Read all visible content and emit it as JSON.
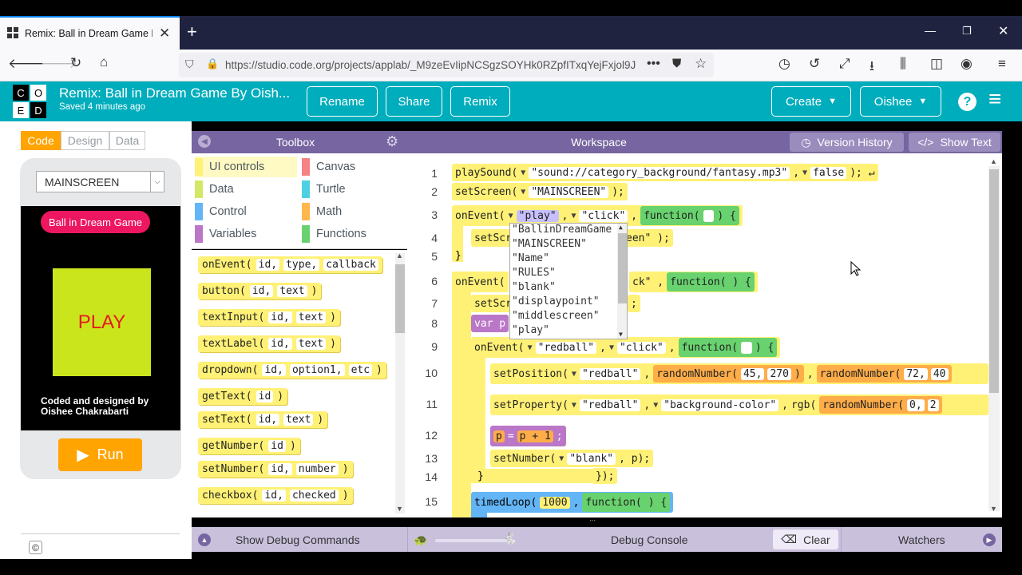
{
  "browser": {
    "tab_title": "Remix: Ball in Dream Game By",
    "url": "https://studio.code.org/projects/applab/_M9zeEvIipNCSgzSOYHk0RZpfITxqYejFxjol9J"
  },
  "header": {
    "logo_letters": [
      "C",
      "O",
      "D",
      "E"
    ],
    "project_title": "Remix: Ball in Dream Game By Oish...",
    "saved_status": "Saved 4 minutes ago",
    "buttons": {
      "rename": "Rename",
      "share": "Share",
      "remix": "Remix",
      "create": "Create",
      "user": "Oishee"
    }
  },
  "modes": {
    "code": "Code",
    "design": "Design",
    "data": "Data"
  },
  "app": {
    "screen_select": "MAINSCREEN",
    "title_label": "Ball in Dream Game",
    "play_label": "PLAY",
    "credits": "Coded and designed by\nOishee Chakrabarti",
    "run_label": "Run",
    "copyright": "©"
  },
  "toolbox": {
    "title": "Toolbox",
    "categories": [
      {
        "label": "UI controls",
        "color": "#fff176"
      },
      {
        "label": "Canvas",
        "color": "#f78183"
      },
      {
        "label": "Data",
        "color": "#d3e965"
      },
      {
        "label": "Turtle",
        "color": "#4dd0e1"
      },
      {
        "label": "Control",
        "color": "#64b5f6"
      },
      {
        "label": "Math",
        "color": "#ffb74d"
      },
      {
        "label": "Variables",
        "color": "#bb77c7"
      },
      {
        "label": "Functions",
        "color": "#68d26e"
      }
    ],
    "blocks": [
      {
        "name": "onEvent(",
        "args": [
          "id,",
          "type,",
          "callback"
        ],
        "end": ""
      },
      {
        "name": "button(",
        "args": [
          "id,",
          "text"
        ],
        "end": ")"
      },
      {
        "name": "textInput(",
        "args": [
          "id,",
          "text"
        ],
        "end": ")"
      },
      {
        "name": "textLabel(",
        "args": [
          "id,",
          "text"
        ],
        "end": ")"
      },
      {
        "name": "dropdown(",
        "args": [
          "id,",
          "option1,",
          "etc"
        ],
        "end": ")"
      },
      {
        "name": "getText(",
        "args": [
          "id"
        ],
        "end": ")"
      },
      {
        "name": "setText(",
        "args": [
          "id,",
          "text"
        ],
        "end": ")"
      },
      {
        "name": "getNumber(",
        "args": [
          "id"
        ],
        "end": ")"
      },
      {
        "name": "setNumber(",
        "args": [
          "id,",
          "number"
        ],
        "end": ")"
      },
      {
        "name": "checkbox(",
        "args": [
          "id,",
          "checked"
        ],
        "end": ")"
      }
    ]
  },
  "workspace": {
    "title": "Workspace",
    "version_history": "Version History",
    "show_text": "Show Text",
    "line_numbers": [
      "1",
      "2",
      "3",
      "4",
      "5",
      "6",
      "7",
      "8",
      "9",
      "10",
      "11",
      "12",
      "13",
      "14",
      "15"
    ],
    "code": {
      "l1_fn": "playSound(",
      "l1_arg1": "\"sound://category_background/fantasy.mp3\"",
      "l1_arg2": "false",
      "l1_end": "); ↵",
      "l2_fn": "setScreen(",
      "l2_arg": "\"MAINSCREEN\"",
      "l2_end": ");",
      "l3_fn": "onEvent(",
      "l3_arg1": "\"play\"",
      "l3_arg2": "\"click\"",
      "l3_func": "function(",
      "l3_end": ") {",
      "l4_fn": "setScr",
      "l4_tail": "een\"  );",
      "l5": "}",
      "l6_fn": "onEvent(",
      "l6_tail": "ck\"  ,",
      "l6_func": "function(  )  {",
      "l7_fn": "setScr",
      "l7_tail": ";",
      "l8_fn": "var p",
      "l9_fn": "onEvent(",
      "l9_arg1": "\"redball\"",
      "l9_arg2": "\"click\"",
      "l9_func": "function(",
      "l9_end": ") {",
      "l10_fn": "setPosition(",
      "l10_arg": "\"redball\"",
      "l10_rand1": "randomNumber(",
      "l10_a": "45,",
      "l10_b": "270",
      "l10_rand2": "randomNumber(",
      "l10_c": "72,",
      "l10_d": "40",
      "l11_fn": "setProperty(",
      "l11_arg1": "\"redball\"",
      "l11_arg2": "\"background-color\"",
      "l11_rgb": "rgb(",
      "l11_rand": "randomNumber(",
      "l11_a": "0,",
      "l11_b": "2",
      "l12_var": "p",
      "l12_eq": "=",
      "l12_expr": "p  +  1",
      "l12_end": ";",
      "l13_fn": "setNumber(",
      "l13_arg": "\"blank\"",
      "l13_tail": ",  p);",
      "l14": "});",
      "l15_fn": "timedLoop(",
      "l15_arg": "1000",
      "l15_func": "function(  )  {"
    },
    "dropdown_options": [
      "\"BallinDreamGame",
      "\"MAINSCREEN\"",
      "\"Name\"",
      "\"RULES\"",
      "\"blank\"",
      "\"displaypoint\"",
      "\"middlescreen\"",
      "\"play\""
    ]
  },
  "debug": {
    "show_commands": "Show Debug Commands",
    "console": "Debug Console",
    "clear": "Clear",
    "watchers": "Watchers"
  },
  "colors": {
    "accent": "#00adbc",
    "toolbox_header": "#7665a0",
    "run_button": "#ffa400",
    "play_bg": "#cbe51d",
    "play_text": "#e31a1c",
    "title_pill": "#ed1660"
  }
}
